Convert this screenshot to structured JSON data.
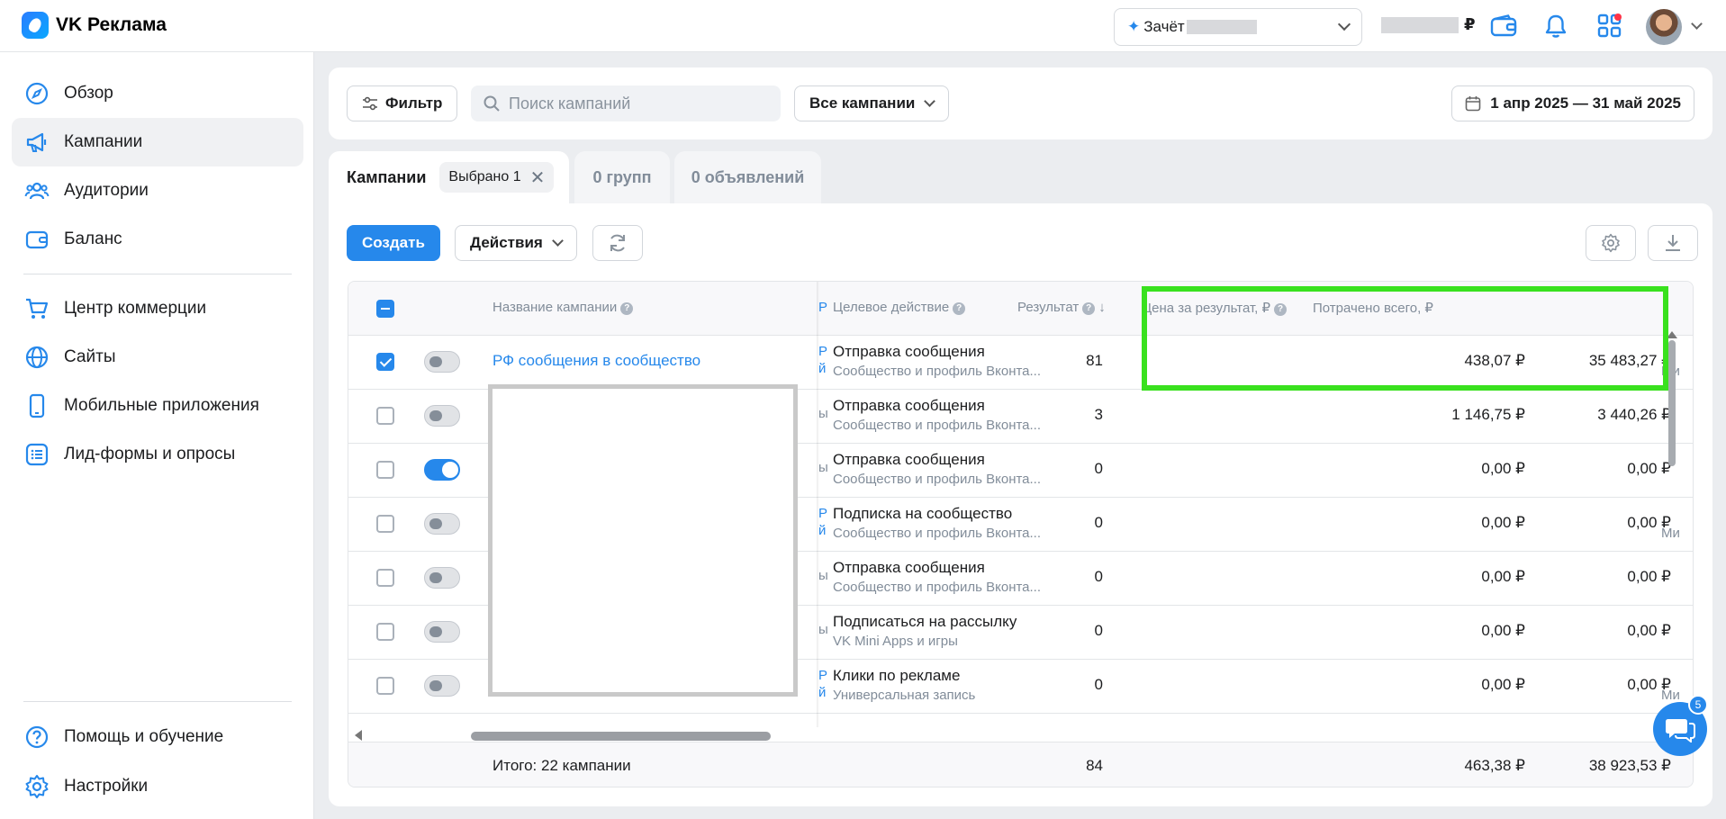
{
  "app": {
    "title": "VK Реклама"
  },
  "header": {
    "account_prefix": "Зачёт",
    "balance_currency": "₽"
  },
  "sidebar": {
    "items": [
      {
        "label": "Обзор",
        "icon": "compass-icon"
      },
      {
        "label": "Кампании",
        "icon": "megaphone-icon",
        "active": true
      },
      {
        "label": "Аудитории",
        "icon": "users-icon"
      },
      {
        "label": "Баланс",
        "icon": "wallet-icon"
      },
      {
        "label": "Центр коммерции",
        "icon": "cart-icon"
      },
      {
        "label": "Сайты",
        "icon": "globe-icon"
      },
      {
        "label": "Мобильные приложения",
        "icon": "phone-icon"
      },
      {
        "label": "Лид-формы и опросы",
        "icon": "list-icon"
      }
    ],
    "bottom": [
      {
        "label": "Помощь и обучение",
        "icon": "help-icon"
      },
      {
        "label": "Настройки",
        "icon": "gear-icon"
      }
    ]
  },
  "filterbar": {
    "filter_label": "Фильтр",
    "search_placeholder": "Поиск кампаний",
    "scope_label": "Все кампании",
    "date_range": "1 апр 2025 — 31 май 2025"
  },
  "tabs": {
    "campaigns": "Кампании",
    "selected_chip": "Выбрано 1",
    "groups": "0 групп",
    "ads": "0 объявлений"
  },
  "toolbar": {
    "create_label": "Создать",
    "actions_label": "Действия"
  },
  "table": {
    "headers": {
      "name": "Название кампании",
      "action": "Целевое действие",
      "result": "Результат",
      "price": "Цена за результат, ₽",
      "spent": "Потрачено всего, ₽"
    },
    "rows": [
      {
        "checked": true,
        "active": false,
        "name": "РФ сообщения в сообщество",
        "clip": "Р\nй",
        "action": "Отправка сообщения",
        "action_sub": "Сообщество и профиль Вконта...",
        "result": "81",
        "price": "438,07 ₽",
        "spent": "35 483,27 ₽",
        "mi": "Ми"
      },
      {
        "checked": false,
        "active": false,
        "name": "",
        "clip": "ы",
        "action": "Отправка сообщения",
        "action_sub": "Сообщество и профиль Вконта...",
        "result": "3",
        "price": "1 146,75 ₽",
        "spent": "3 440,26 ₽",
        "mi": ""
      },
      {
        "checked": false,
        "active": true,
        "name": "",
        "clip": "ы",
        "action": "Отправка сообщения",
        "action_sub": "Сообщество и профиль Вконта...",
        "result": "0",
        "price": "0,00 ₽",
        "spent": "0,00 ₽",
        "mi": ""
      },
      {
        "checked": false,
        "active": false,
        "name": "",
        "clip": "Р\nй",
        "action": "Подписка на сообщество",
        "action_sub": "Сообщество и профиль Вконта...",
        "result": "0",
        "price": "0,00 ₽",
        "spent": "0,00 ₽",
        "mi": "Ми"
      },
      {
        "checked": false,
        "active": false,
        "name": "",
        "clip": "ы",
        "action": "Отправка сообщения",
        "action_sub": "Сообщество и профиль Вконта...",
        "result": "0",
        "price": "0,00 ₽",
        "spent": "0,00 ₽",
        "mi": ""
      },
      {
        "checked": false,
        "active": false,
        "name": "",
        "clip": "ы",
        "action": "Подписаться на рассылку",
        "action_sub": "VK Mini Apps и игры",
        "result": "0",
        "price": "0,00 ₽",
        "spent": "0,00 ₽",
        "mi": ""
      },
      {
        "checked": false,
        "active": false,
        "name": "",
        "clip": "Р\nй",
        "action": "Клики по рекламе",
        "action_sub": "Универсальная запись",
        "result": "0",
        "price": "0,00 ₽",
        "spent": "0,00 ₽",
        "mi": "Ми"
      }
    ],
    "footer": {
      "label": "Итого: 22 кампании",
      "result": "84",
      "price": "463,38 ₽",
      "spent": "38 923,53 ₽"
    }
  },
  "chat": {
    "badge": "5"
  },
  "colors": {
    "accent": "#2688eb",
    "highlight": "#39e11e"
  }
}
